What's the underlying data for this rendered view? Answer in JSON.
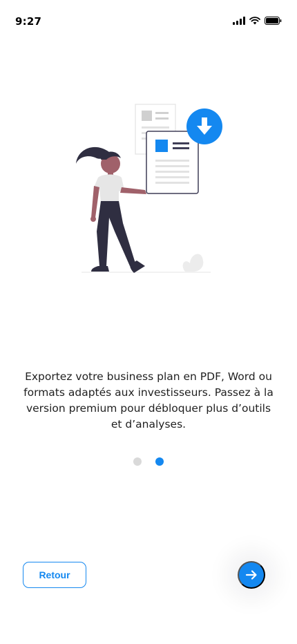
{
  "status_bar": {
    "time": "9:27",
    "icons": [
      "signal-icon",
      "wifi-icon",
      "battery-icon"
    ]
  },
  "onboarding": {
    "illustration": "woman-document-download-illustration",
    "description": "Exportez votre business plan en PDF, Word ou formats adaptés aux investisseurs. Passez à la version premium pour débloquer plus d’outils et d’analyses.",
    "pager": {
      "total": 2,
      "active_index": 1
    }
  },
  "footer": {
    "back_label": "Retour",
    "next_icon": "arrow-right-icon"
  },
  "colors": {
    "accent": "#1488f0",
    "inactive_dot": "#d9d9d9",
    "text": "#1f1f1f"
  }
}
